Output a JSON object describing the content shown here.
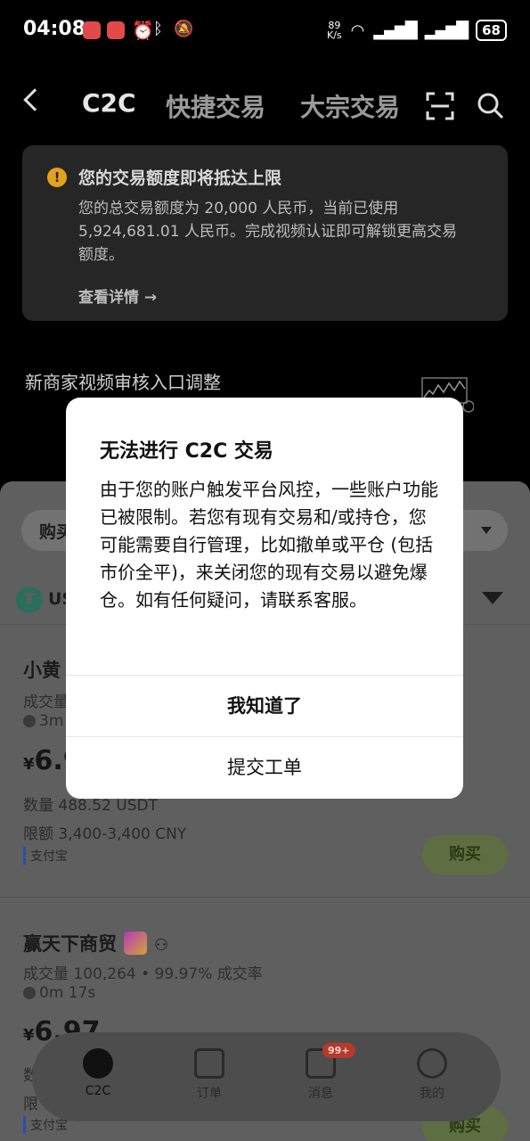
{
  "status_bar": {
    "time": "04:08",
    "net_speed_value": "89",
    "net_speed_unit": "K/s",
    "battery": "68"
  },
  "header": {
    "tabs": [
      {
        "label": "C2C",
        "active": true
      },
      {
        "label": "快捷交易",
        "active": false
      },
      {
        "label": "大宗交易",
        "active": false
      }
    ],
    "icons": [
      "back-icon",
      "scan-icon",
      "search-icon"
    ]
  },
  "limit_banner": {
    "title": "您的交易额度即将抵达上限",
    "body": "您的总交易额度为 20,000 人民币，当前已使用 5,924,681.01 人民币。完成视频认证即可解锁更高交易额度。",
    "link": "查看详情 →"
  },
  "notice": "新商家视频审核入口调整",
  "sheet": {
    "chip_label": "购买",
    "coin_label": "US",
    "merchants": [
      {
        "name": "小黄",
        "stats": "成交量",
        "time": "3m",
        "currency": "¥",
        "price": "6.9",
        "quantity": "数量 488.52 USDT",
        "limit": "限额 3,400-3,400 CNY",
        "payment": "支付宝",
        "buy_label": "购买"
      },
      {
        "name": "赢天下商贸",
        "stats": "成交量 100,264  •  99.97% 成交率",
        "time": "0m 17s",
        "currency": "¥",
        "price": "6.97",
        "quantity": "数",
        "limit": "限",
        "payment": "支付宝",
        "buy_label": "购买"
      }
    ]
  },
  "bottom_nav": {
    "items": [
      {
        "label": "C2C",
        "icon": "people-icon",
        "active": true
      },
      {
        "label": "订单",
        "icon": "order-icon",
        "active": false
      },
      {
        "label": "消息",
        "icon": "message-icon",
        "active": false,
        "badge": "99+"
      },
      {
        "label": "我的",
        "icon": "profile-icon",
        "active": false
      }
    ]
  },
  "dialog": {
    "title": "无法进行 C2C 交易",
    "body": "由于您的账户触发平台风控，一些账户功能已被限制。若您有现有交易和/或持仓，您可能需要自行管理，比如撤单或平仓 (包括市价全平)，来关闭您的现有交易以避免爆仓。如有任何疑问，请联系客服。",
    "primary_button": "我知道了",
    "secondary_button": "提交工单"
  }
}
